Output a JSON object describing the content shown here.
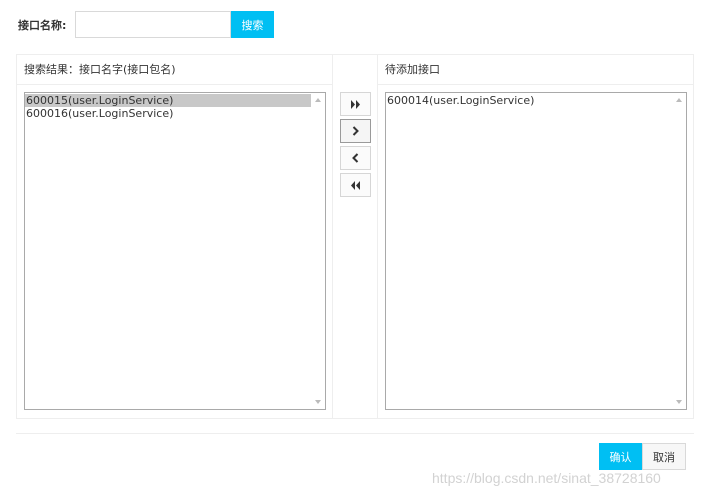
{
  "search": {
    "label": "接口名称:",
    "value": "",
    "placeholder": "",
    "button_label": "搜索"
  },
  "left_panel": {
    "header": "搜索结果：接口名字(接口包名)",
    "items": [
      {
        "label": "600015(user.LoginService)",
        "selected": true
      },
      {
        "label": "600016(user.LoginService)",
        "selected": false
      }
    ]
  },
  "right_panel": {
    "header": "待添加接口",
    "items": [
      {
        "label": "600014(user.LoginService)",
        "selected": false
      }
    ]
  },
  "transfer_buttons": {
    "move_all_right": "double-chevron-right-icon",
    "move_right": "chevron-right-icon",
    "move_left": "chevron-left-icon",
    "move_all_left": "double-chevron-left-icon"
  },
  "footer": {
    "confirm_label": "确认",
    "cancel_label": "取消"
  },
  "watermark": "https://blog.csdn.net/sinat_38728160",
  "colors": {
    "accent": "#00bff3",
    "selected_row": "#c8c8c8",
    "border": "#eeeeee"
  }
}
